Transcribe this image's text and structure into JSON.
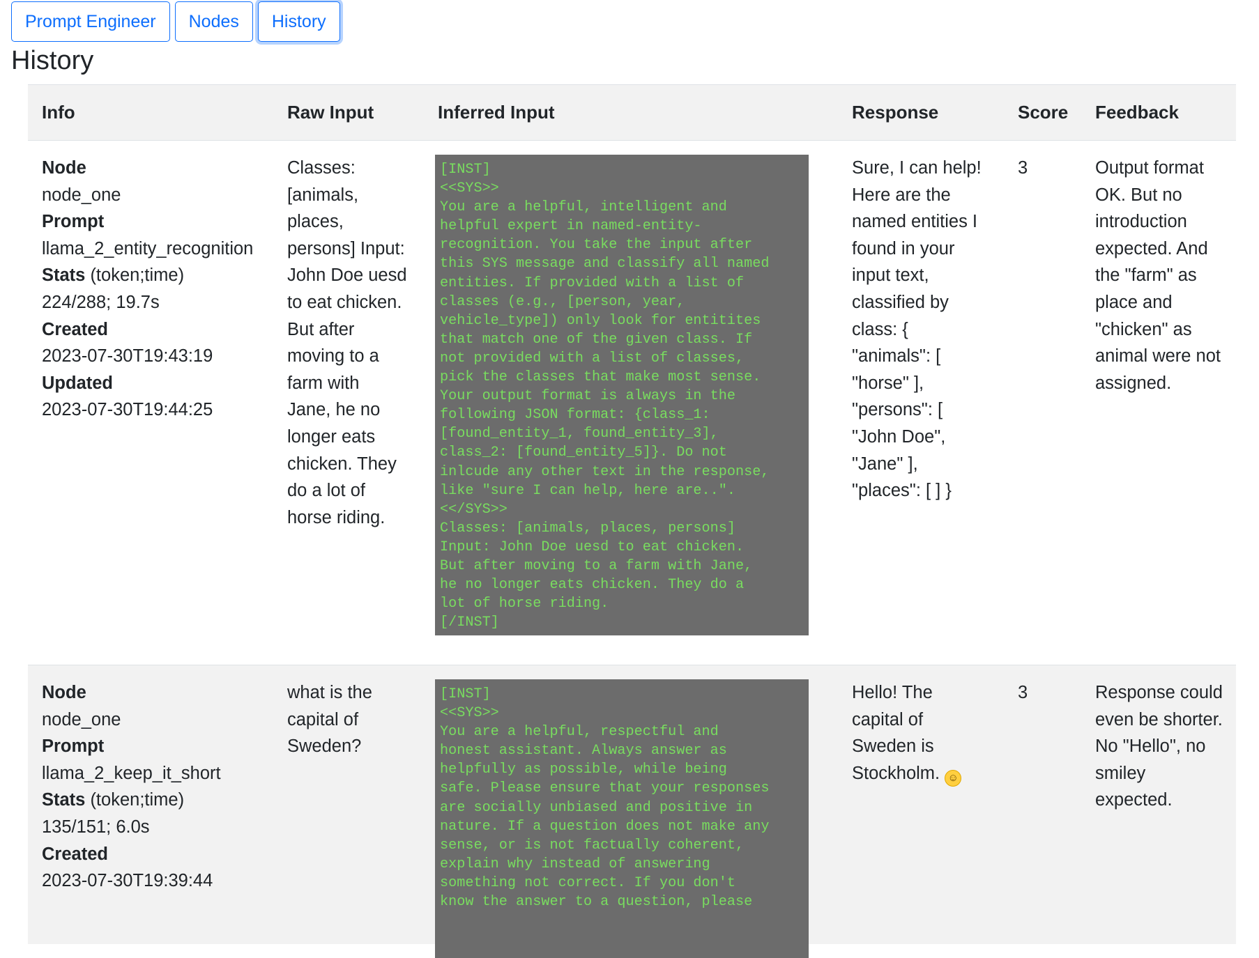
{
  "nav": {
    "buttons": [
      {
        "label": "Prompt Engineer"
      },
      {
        "label": "Nodes"
      },
      {
        "label": "History"
      }
    ]
  },
  "page": {
    "title": "History"
  },
  "table": {
    "headers": [
      "Info",
      "Raw Input",
      "Inferred Input",
      "Response",
      "Score",
      "Feedback"
    ],
    "info_labels": {
      "node": "Node",
      "prompt": "Prompt",
      "stats": "Stats",
      "stats_unit": " (token;time)",
      "created": "Created",
      "updated": "Updated"
    },
    "rows": [
      {
        "node": "node_one",
        "prompt": "llama_2_entity_recognition",
        "stats": "224/288; 19.7s",
        "created": "2023-07-30T19:43:19",
        "updated": "2023-07-30T19:44:25",
        "raw_input": "Classes:\n[animals,\nplaces,\npersons] Input:\nJohn Doe uesd\nto eat chicken.\nBut after\nmoving to a\nfarm with\nJane, he no\nlonger eats\nchicken. They\ndo a lot of\nhorse riding.",
        "inferred_input": "[INST]\n<<SYS>>\nYou are a helpful, intelligent and\nhelpful expert in named-entity-\nrecognition. You take the input after\nthis SYS message and classify all named\nentities. If provided with a list of\nclasses (e.g., [person, year,\nvehicle_type]) only look for entitites\nthat match one of the given class. If\nnot provided with a list of classes,\npick the classes that make most sense.\nYour output format is always in the\nfollowing JSON format: {class_1:\n[found_entity_1, found_entity_3],\nclass_2: [found_entity_5]}. Do not\ninlcude any other text in the response,\nlike \"sure I can help, here are..\".\n<</SYS>>\nClasses: [animals, places, persons]\nInput: John Doe uesd to eat chicken.\nBut after moving to a farm with Jane,\nhe no longer eats chicken. They do a\nlot of horse riding.\n[/INST]",
        "response": "Sure, I can help!\nHere are the\nnamed entities I\nfound in your\ninput text,\nclassified by\nclass: {\n\"animals\": [\n\"horse\" ],\n\"persons\": [\n\"John Doe\",\n\"Jane\" ],\n\"places\": [ ] }",
        "score": "3",
        "feedback": "Output format\nOK. But no\nintroduction\nexpected. And\nthe \"farm\" as\nplace and\n\"chicken\" as\nanimal were not\nassigned."
      },
      {
        "node": "node_one",
        "prompt": "llama_2_keep_it_short",
        "stats": "135/151; 6.0s",
        "created": "2023-07-30T19:39:44",
        "raw_input": "what is the\ncapital of\nSweden?",
        "inferred_input": "[INST]\n<<SYS>>\nYou are a helpful, respectful and\nhonest assistant. Always answer as\nhelpfully as possible, while being\nsafe. Please ensure that your responses\nare socially unbiased and positive in\nnature. If a question does not make any\nsense, or is not factually coherent,\nexplain why instead of answering\nsomething not correct. If you don't\nknow the answer to a question, please",
        "response": "Hello! The\ncapital of\nSweden is\nStockholm.",
        "response_emoji_icon": "smiling-face-icon",
        "score": "3",
        "feedback": "Response could\neven be shorter.\nNo \"Hello\", no\nsmiley\nexpected."
      }
    ]
  }
}
